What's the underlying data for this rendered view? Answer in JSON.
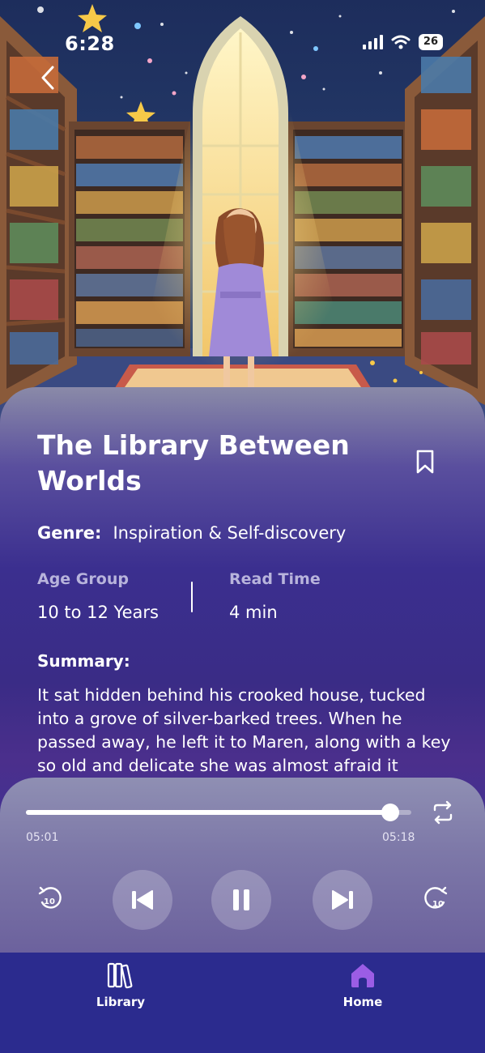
{
  "status_bar": {
    "time": "6:28",
    "battery": "26"
  },
  "story": {
    "title": "The Library Between Worlds",
    "genre_label": "Genre:",
    "genre": "Inspiration & Self-discovery",
    "age_group_label": "Age Group",
    "age_group": "10 to 12 Years",
    "read_time_label": "Read Time",
    "read_time": "4 min",
    "summary_label": "Summary:",
    "summary": "It sat hidden behind his crooked house, tucked into a grove of silver-barked trees. When he passed away, he left it to Maren, along with a key so old and delicate she was almost afraid it"
  },
  "player": {
    "current_time": "05:01",
    "duration": "05:18",
    "progress": 0.946,
    "rewind_seconds": "10",
    "forward_seconds": "10"
  },
  "nav": {
    "items": [
      {
        "label": "Library",
        "icon": "books-icon"
      },
      {
        "label": "Home",
        "icon": "home-icon",
        "active": true
      }
    ]
  },
  "colors": {
    "nav_background": "#2b2b8e",
    "active_icon": "#9b5de5",
    "sheet_accent": "#3b2f8f"
  }
}
